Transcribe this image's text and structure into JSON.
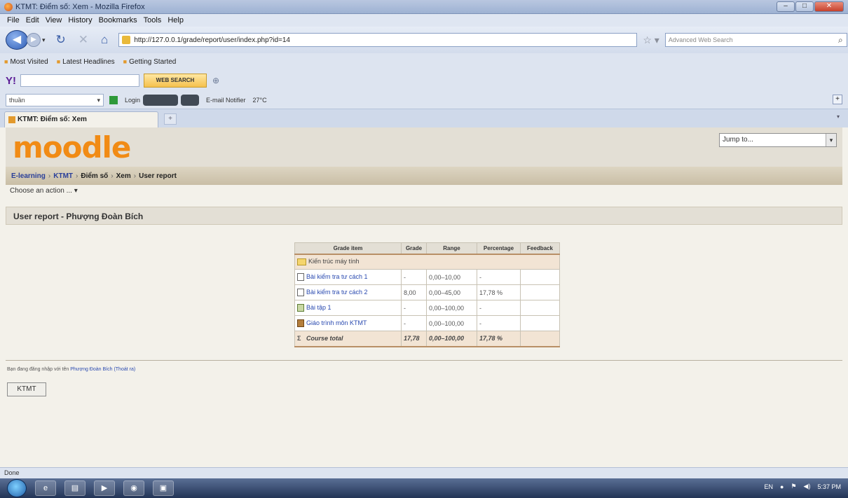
{
  "window": {
    "title": "KTMT: Điểm số: Xem - Mozilla Firefox"
  },
  "menu": [
    "File",
    "Edit",
    "View",
    "History",
    "Bookmarks",
    "Tools",
    "Help"
  ],
  "nav": {
    "url": "http://127.0.0.1/grade/report/user/index.php?id=14",
    "search_placeholder": "Advanced Web Search"
  },
  "bookmarks": [
    "Most Visited",
    "Latest Headlines",
    "Getting Started"
  ],
  "yahoo": {
    "logo": "Y!",
    "search_button": "WEB SEARCH"
  },
  "toolbar3": {
    "profile": "thuần",
    "login": "Login",
    "email": "E-mail Notifier",
    "temp": "27°C"
  },
  "tab": {
    "title": "KTMT: Điểm số: Xem"
  },
  "page": {
    "logo": "moodle",
    "jump_to": "Jump to...",
    "breadcrumb": {
      "home": "E-learning",
      "course": "KTMT",
      "grades": "Điểm số",
      "view": "Xem",
      "report": "User report"
    },
    "choose_action": "Choose an action ...",
    "heading": "User report - Phượng Đoàn Bích"
  },
  "grades_table": {
    "headers": [
      "Grade item",
      "Grade",
      "Range",
      "Percentage",
      "Feedback"
    ],
    "category": "Kiến trúc máy tính",
    "rows": [
      {
        "item": "Bài kiểm tra tư cách 1",
        "grade": "-",
        "range": "0,00–10,00",
        "percentage": "-",
        "feedback": ""
      },
      {
        "item": "Bài kiểm tra tư cách 2",
        "grade": "8,00",
        "range": "0,00–45,00",
        "percentage": "17,78 %",
        "feedback": ""
      },
      {
        "item": "Bài tập 1",
        "grade": "-",
        "range": "0,00–100,00",
        "percentage": "-",
        "feedback": ""
      },
      {
        "item": "Giáo trình môn KTMT",
        "grade": "-",
        "range": "0,00–100,00",
        "percentage": "-",
        "feedback": ""
      }
    ],
    "total": {
      "label": "Course total",
      "grade": "17,78",
      "range": "0,00–100,00",
      "percentage": "17,78 %"
    }
  },
  "footer": {
    "login_prefix": "Bạn đang đăng nhập với tên",
    "user": "Phượng Đoàn Bích",
    "logout": "(Thoát ra)",
    "course_button": "KTMT"
  },
  "status": "Done",
  "tray": {
    "lang": "EN",
    "clock": "5:37 PM"
  }
}
